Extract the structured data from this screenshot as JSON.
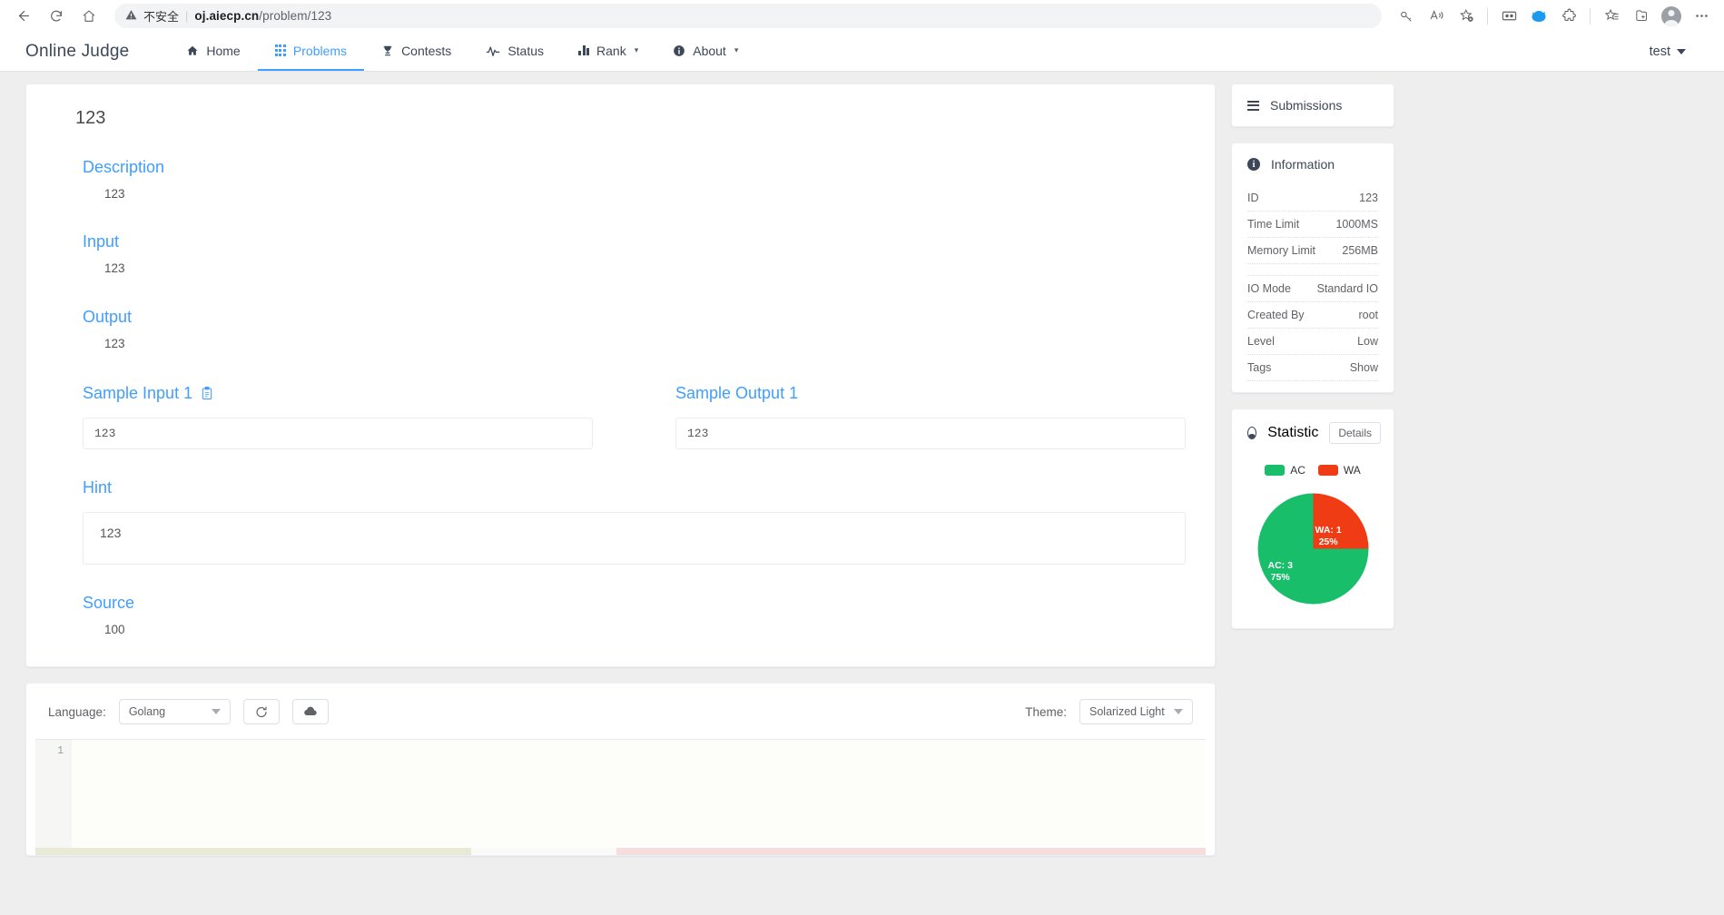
{
  "browser": {
    "back_icon": "back-arrow-icon",
    "reload_icon": "reload-icon",
    "home_icon": "home-icon",
    "security_warning_icon": "warning-triangle-icon",
    "security_label": "不安全",
    "url_host": "oj.aiecp.cn",
    "url_path": "/problem/123",
    "toolbar_icons": [
      "key-icon",
      "read-aloud-icon",
      "add-favorite-icon",
      "split-screen-icon",
      "copilot-icon",
      "extensions-icon",
      "favorites-icon",
      "collections-icon",
      "profile-avatar-icon",
      "settings-more-icon"
    ]
  },
  "navbar": {
    "brand": "Online Judge",
    "items": [
      {
        "label": "Home",
        "icon": "home-icon",
        "active": false,
        "caret": false
      },
      {
        "label": "Problems",
        "icon": "grid-icon",
        "active": true,
        "caret": false
      },
      {
        "label": "Contests",
        "icon": "trophy-icon",
        "active": false,
        "caret": false
      },
      {
        "label": "Status",
        "icon": "pulse-icon",
        "active": false,
        "caret": false
      },
      {
        "label": "Rank",
        "icon": "bar-chart-icon",
        "active": false,
        "caret": true
      },
      {
        "label": "About",
        "icon": "info-circle-icon",
        "active": false,
        "caret": true
      }
    ],
    "user": "test",
    "accent_color": "#409eff"
  },
  "problem": {
    "title": "123",
    "sections": [
      {
        "heading": "Description",
        "body": "123"
      },
      {
        "heading": "Input",
        "body": "123"
      },
      {
        "heading": "Output",
        "body": "123"
      }
    ],
    "sample_input": {
      "heading": "Sample Input 1",
      "copy_icon": "clipboard-copy-icon",
      "value": "123"
    },
    "sample_output": {
      "heading": "Sample Output 1",
      "value": "123"
    },
    "hint": {
      "heading": "Hint",
      "value": "123"
    },
    "source": {
      "heading": "Source",
      "value": "100"
    }
  },
  "sidebar": {
    "submissions": {
      "label": "Submissions",
      "icon": "hamburger-icon"
    },
    "information": {
      "label": "Information",
      "icon": "info-circle-icon",
      "rows": [
        {
          "key": "ID",
          "value": "123"
        },
        {
          "key": "Time Limit",
          "value": "1000MS"
        },
        {
          "key": "Memory Limit",
          "value": "256MB"
        },
        {
          "key": "",
          "value": ""
        },
        {
          "key": "IO Mode",
          "value": "Standard IO"
        },
        {
          "key": "Created By",
          "value": "root"
        },
        {
          "key": "Level",
          "value": "Low"
        },
        {
          "key": "Tags",
          "value": "Show",
          "link": true
        }
      ]
    },
    "statistic": {
      "label": "Statistic",
      "icon": "pie-chart-icon",
      "details_label": "Details"
    }
  },
  "chart_data": {
    "type": "pie",
    "title": "Statistic",
    "categories": [
      "AC",
      "WA"
    ],
    "values": [
      3,
      1
    ],
    "percentages": [
      75,
      25
    ],
    "colors": [
      "#19be6b",
      "#f03c15"
    ],
    "labels": [
      "AC: 3\n75%",
      "WA: 1\n25%"
    ],
    "legend": [
      "AC",
      "WA"
    ],
    "legend_position": "top",
    "ac_label_line1": "AC: 3",
    "ac_label_line2": "75%",
    "wa_label_line1": "WA: 1",
    "wa_label_line2": "25%"
  },
  "editor": {
    "language_label": "Language:",
    "language_value": "Golang",
    "reset_icon": "refresh-icon",
    "upload_icon": "cloud-upload-icon",
    "theme_label": "Theme:",
    "theme_value": "Solarized Light",
    "line_number": "1",
    "code": ""
  }
}
